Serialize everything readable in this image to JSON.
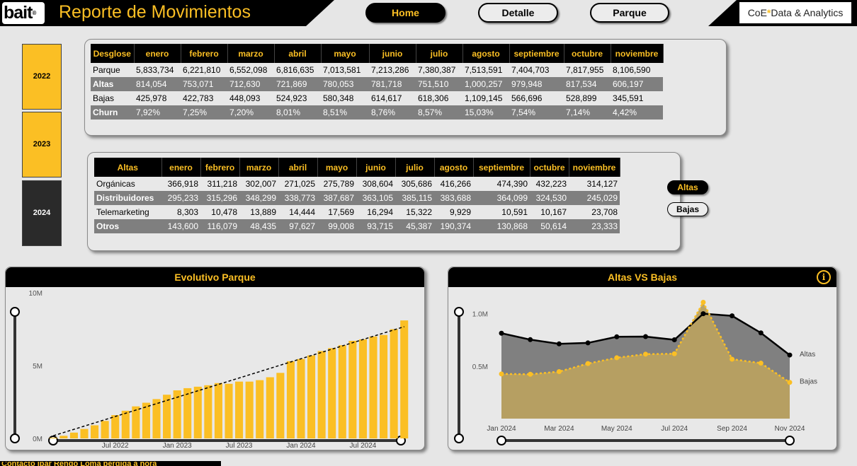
{
  "header": {
    "logo_text": "bait",
    "logo_mark": "®",
    "title": "Reporte de Movimientos",
    "nav": [
      {
        "label": "Home",
        "active": true
      },
      {
        "label": "Detalle",
        "active": false
      },
      {
        "label": "Parque",
        "active": false
      }
    ],
    "coe_prefix": "CoE",
    "coe_spark": "*",
    "coe_suffix": "Data & Analytics"
  },
  "years": [
    "2022",
    "2023",
    "2024"
  ],
  "selected_year": "2024",
  "table1": {
    "header_label": "Desglose",
    "months": [
      "enero",
      "febrero",
      "marzo",
      "abril",
      "mayo",
      "junio",
      "julio",
      "agosto",
      "septiembre",
      "octubre",
      "noviembre"
    ],
    "rows": [
      {
        "label": "Parque",
        "values": [
          "5,833,734",
          "6,221,810",
          "6,552,098",
          "6,816,635",
          "7,013,581",
          "7,213,286",
          "7,380,387",
          "7,513,591",
          "7,404,703",
          "7,817,955",
          "8,106,590"
        ]
      },
      {
        "label": "Altas",
        "values": [
          "814,054",
          "753,071",
          "712,630",
          "721,869",
          "780,053",
          "781,718",
          "751,510",
          "1,000,257",
          "979,948",
          "817,534",
          "606,197"
        ]
      },
      {
        "label": "Bajas",
        "values": [
          "425,978",
          "422,783",
          "448,093",
          "524,923",
          "580,348",
          "614,617",
          "618,306",
          "1,109,145",
          "566,696",
          "528,899",
          "345,591"
        ]
      },
      {
        "label": "Churn",
        "values": [
          "7,92%",
          "7,25%",
          "7,20%",
          "8,01%",
          "8,51%",
          "8,76%",
          "8,57%",
          "15,03%",
          "7,54%",
          "7,14%",
          "4,42%"
        ]
      }
    ]
  },
  "table2": {
    "header_label": "Altas",
    "months": [
      "enero",
      "febrero",
      "marzo",
      "abril",
      "mayo",
      "junio",
      "julio",
      "agosto",
      "septiembre",
      "octubre",
      "noviembre"
    ],
    "rows": [
      {
        "label": "Orgánicas",
        "values": [
          "366,918",
          "311,218",
          "302,007",
          "271,025",
          "275,789",
          "308,604",
          "305,686",
          "416,266",
          "474,390",
          "432,223",
          "314,127"
        ]
      },
      {
        "label": "Distribuidores",
        "values": [
          "295,233",
          "315,296",
          "348,299",
          "338,773",
          "387,687",
          "363,105",
          "385,115",
          "383,688",
          "364,099",
          "324,530",
          "245,029"
        ]
      },
      {
        "label": "Telemarketing",
        "values": [
          "8,303",
          "10,478",
          "13,889",
          "14,444",
          "17,569",
          "16,294",
          "15,322",
          "9,929",
          "10,591",
          "10,167",
          "23,708"
        ]
      },
      {
        "label": "Otros",
        "values": [
          "143,600",
          "116,079",
          "48,435",
          "97,627",
          "99,008",
          "93,715",
          "45,387",
          "190,374",
          "130,868",
          "50,614",
          "23,333"
        ]
      }
    ]
  },
  "toggles": [
    {
      "label": "Altas",
      "active": true
    },
    {
      "label": "Bajas",
      "active": false
    }
  ],
  "bottom_text": "Contacto Ibar Rendo Loma perdida a hora",
  "chart_data": [
    {
      "type": "bar",
      "title": "Evolutivo Parque",
      "ylim": [
        0,
        10000000
      ],
      "yticks": [
        {
          "value": 0,
          "label": "0M"
        },
        {
          "value": 5000000,
          "label": "5M"
        },
        {
          "value": 10000000,
          "label": "10M"
        }
      ],
      "xticks": [
        {
          "index": 6,
          "label": "Jul 2022"
        },
        {
          "index": 12,
          "label": "Jan 2023"
        },
        {
          "index": 18,
          "label": "Jul 2023"
        },
        {
          "index": 24,
          "label": "Jan 2024"
        },
        {
          "index": 30,
          "label": "Jul 2024"
        }
      ],
      "categories": [
        "Jan 2022",
        "Feb 2022",
        "Mar 2022",
        "Apr 2022",
        "May 2022",
        "Jun 2022",
        "Jul 2022",
        "Aug 2022",
        "Sep 2022",
        "Oct 2022",
        "Nov 2022",
        "Dec 2022",
        "Jan 2023",
        "Feb 2023",
        "Mar 2023",
        "Apr 2023",
        "May 2023",
        "Jun 2023",
        "Jul 2023",
        "Aug 2023",
        "Sep 2023",
        "Oct 2023",
        "Nov 2023",
        "Dec 2023",
        "Jan 2024",
        "Feb 2024",
        "Mar 2024",
        "Apr 2024",
        "May 2024",
        "Jun 2024",
        "Jul 2024",
        "Aug 2024",
        "Sep 2024",
        "Oct 2024",
        "Nov 2024"
      ],
      "values": [
        50000,
        180000,
        400000,
        650000,
        900000,
        1200000,
        1600000,
        1900000,
        2200000,
        2450000,
        2700000,
        3000000,
        3300000,
        3450000,
        3550000,
        3650000,
        3800000,
        3750000,
        3900000,
        3900000,
        4000000,
        4200000,
        4500000,
        5300000,
        5450000,
        5700000,
        6000000,
        6200000,
        6400000,
        6700000,
        6800000,
        7000000,
        7100000,
        7500000,
        8100000
      ],
      "trendline": true,
      "bar_color": "#fbbf24"
    },
    {
      "type": "area",
      "title": "Altas VS Bajas",
      "ylim": [
        0,
        1200000
      ],
      "yticks": [
        {
          "value": 500000,
          "label": "0.5M"
        },
        {
          "value": 1000000,
          "label": "1.0M"
        }
      ],
      "x": [
        "Jan 2024",
        "Feb 2024",
        "Mar 2024",
        "Apr 2024",
        "May 2024",
        "Jun 2024",
        "Jul 2024",
        "Aug 2024",
        "Sep 2024",
        "Oct 2024",
        "Nov 2024"
      ],
      "xticks": [
        {
          "index": 0,
          "label": "Jan 2024"
        },
        {
          "index": 2,
          "label": "Mar 2024"
        },
        {
          "index": 4,
          "label": "May 2024"
        },
        {
          "index": 6,
          "label": "Jul 2024"
        },
        {
          "index": 8,
          "label": "Sep 2024"
        },
        {
          "index": 10,
          "label": "Nov 2024"
        }
      ],
      "series": [
        {
          "name": "Altas",
          "values": [
            814054,
            753071,
            712630,
            721869,
            780053,
            781718,
            751510,
            1000257,
            979948,
            817534,
            606197
          ],
          "color": "#000000",
          "fill": "#808080"
        },
        {
          "name": "Bajas",
          "values": [
            425978,
            422783,
            448093,
            524923,
            580348,
            614617,
            618306,
            1109145,
            566696,
            528899,
            345591
          ],
          "color": "#fbbf24",
          "fill": "#b8a060"
        }
      ]
    }
  ]
}
